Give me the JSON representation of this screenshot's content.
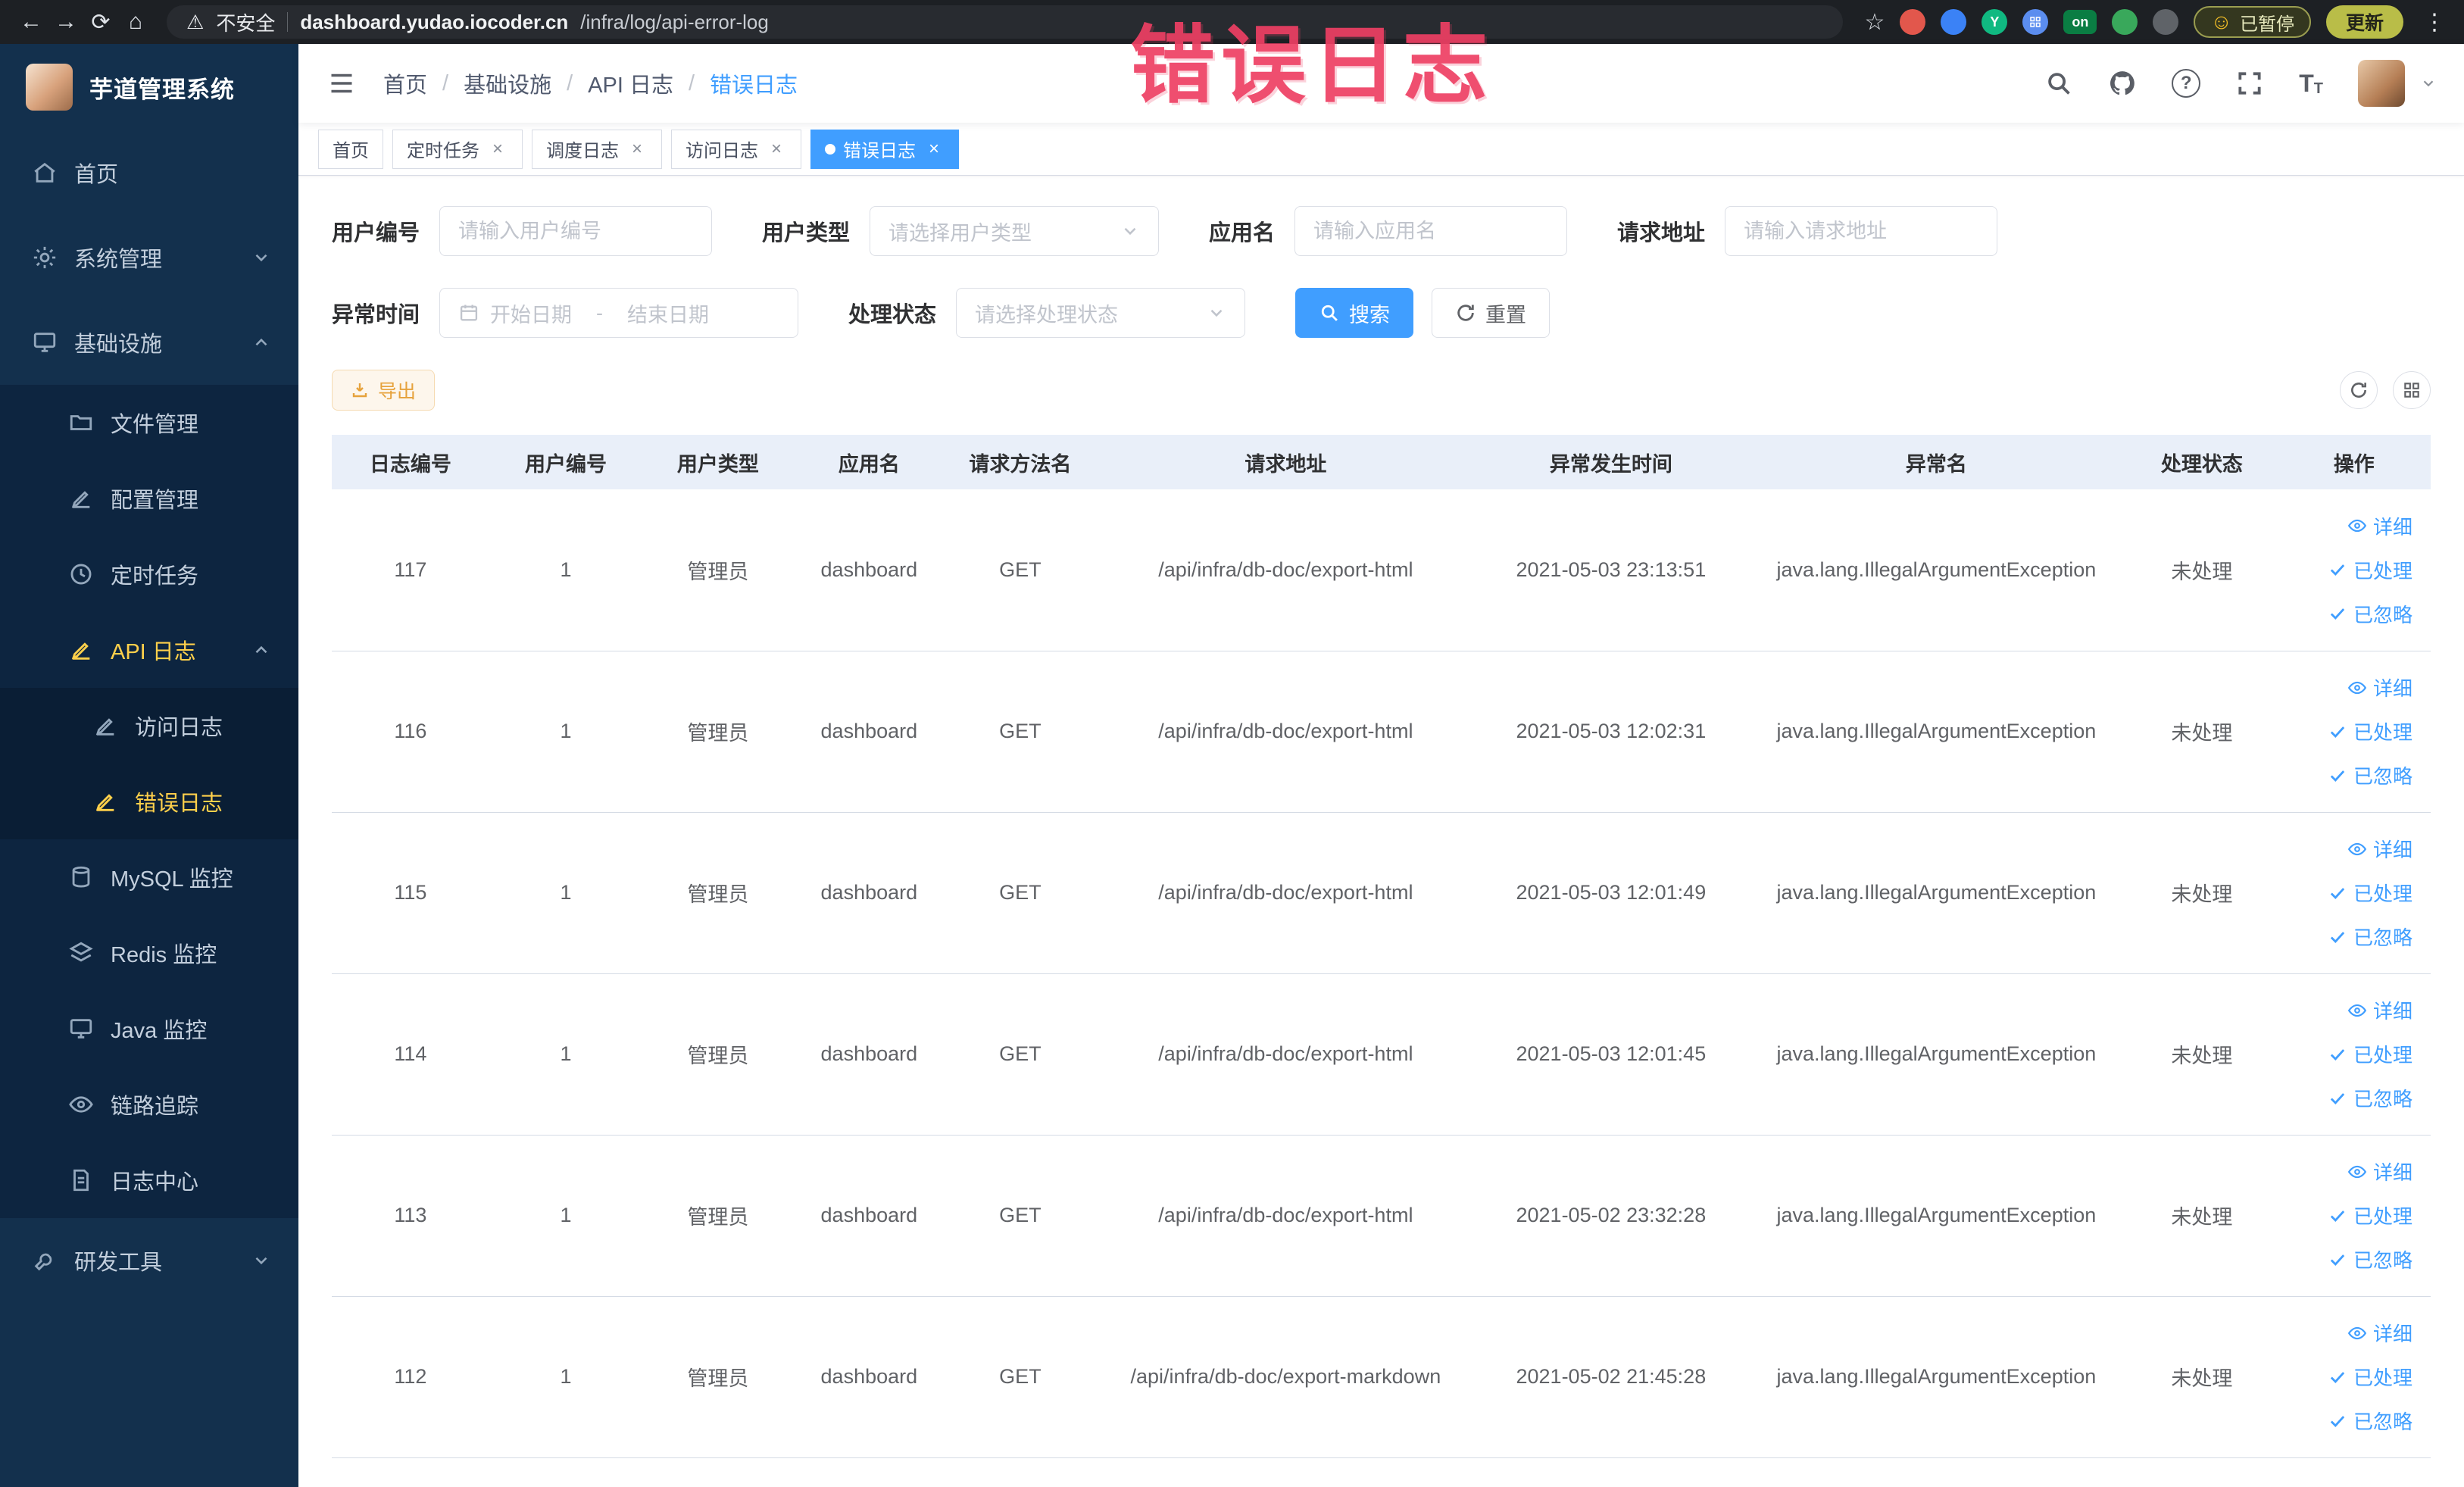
{
  "browser": {
    "security_warning": "不安全",
    "url_domain": "dashboard.yudao.iocoder.cn",
    "url_path": "/infra/log/api-error-log",
    "extension_on_badge": "on",
    "paused_badge": "已暂停",
    "update_button": "更新"
  },
  "annotation": {
    "text": "错误日志"
  },
  "sidebar": {
    "logo_title": "芋道管理系统",
    "items": [
      {
        "label": "首页"
      },
      {
        "label": "系统管理"
      },
      {
        "label": "基础设施"
      },
      {
        "label": "文件管理"
      },
      {
        "label": "配置管理"
      },
      {
        "label": "定时任务"
      },
      {
        "label": "API 日志"
      },
      {
        "label": "访问日志"
      },
      {
        "label": "错误日志"
      },
      {
        "label": "MySQL 监控"
      },
      {
        "label": "Redis 监控"
      },
      {
        "label": "Java 监控"
      },
      {
        "label": "链路追踪"
      },
      {
        "label": "日志中心"
      },
      {
        "label": "研发工具"
      }
    ]
  },
  "breadcrumb": {
    "separator": "/",
    "items": [
      "首页",
      "基础设施",
      "API 日志",
      "错误日志"
    ]
  },
  "tabs": [
    {
      "label": "首页"
    },
    {
      "label": "定时任务"
    },
    {
      "label": "调度日志"
    },
    {
      "label": "访问日志"
    },
    {
      "label": "错误日志"
    }
  ],
  "filters": {
    "user_id_label": "用户编号",
    "user_id_placeholder": "请输入用户编号",
    "user_type_label": "用户类型",
    "user_type_placeholder": "请选择用户类型",
    "app_name_label": "应用名",
    "app_name_placeholder": "请输入应用名",
    "request_url_label": "请求地址",
    "request_url_placeholder": "请输入请求地址",
    "exception_time_label": "异常时间",
    "date_start_placeholder": "开始日期",
    "date_separator": "-",
    "date_end_placeholder": "结束日期",
    "process_status_label": "处理状态",
    "process_status_placeholder": "请选择处理状态",
    "search_button": "搜索",
    "reset_button": "重置"
  },
  "toolbar": {
    "export_button": "导出"
  },
  "table": {
    "columns": [
      "日志编号",
      "用户编号",
      "用户类型",
      "应用名",
      "请求方法名",
      "请求地址",
      "异常发生时间",
      "异常名",
      "处理状态",
      "操作"
    ],
    "actions": {
      "detail": "详细",
      "processed": "已处理",
      "ignored": "已忽略"
    },
    "rows": [
      {
        "id": "117",
        "user_id": "1",
        "user_type": "管理员",
        "app_name": "dashboard",
        "method": "GET",
        "url": "/api/infra/db-doc/export-html",
        "time": "2021-05-03 23:13:51",
        "exception": "java.lang.IllegalArgumentException",
        "status": "未处理"
      },
      {
        "id": "116",
        "user_id": "1",
        "user_type": "管理员",
        "app_name": "dashboard",
        "method": "GET",
        "url": "/api/infra/db-doc/export-html",
        "time": "2021-05-03 12:02:31",
        "exception": "java.lang.IllegalArgumentException",
        "status": "未处理"
      },
      {
        "id": "115",
        "user_id": "1",
        "user_type": "管理员",
        "app_name": "dashboard",
        "method": "GET",
        "url": "/api/infra/db-doc/export-html",
        "time": "2021-05-03 12:01:49",
        "exception": "java.lang.IllegalArgumentException",
        "status": "未处理"
      },
      {
        "id": "114",
        "user_id": "1",
        "user_type": "管理员",
        "app_name": "dashboard",
        "method": "GET",
        "url": "/api/infra/db-doc/export-html",
        "time": "2021-05-03 12:01:45",
        "exception": "java.lang.IllegalArgumentException",
        "status": "未处理"
      },
      {
        "id": "113",
        "user_id": "1",
        "user_type": "管理员",
        "app_name": "dashboard",
        "method": "GET",
        "url": "/api/infra/db-doc/export-html",
        "time": "2021-05-02 23:32:28",
        "exception": "java.lang.IllegalArgumentException",
        "status": "未处理"
      },
      {
        "id": "112",
        "user_id": "1",
        "user_type": "管理员",
        "app_name": "dashboard",
        "method": "GET",
        "url": "/api/infra/db-doc/export-markdown",
        "time": "2021-05-02 21:45:28",
        "exception": "java.lang.IllegalArgumentException",
        "status": "未处理"
      }
    ]
  }
}
